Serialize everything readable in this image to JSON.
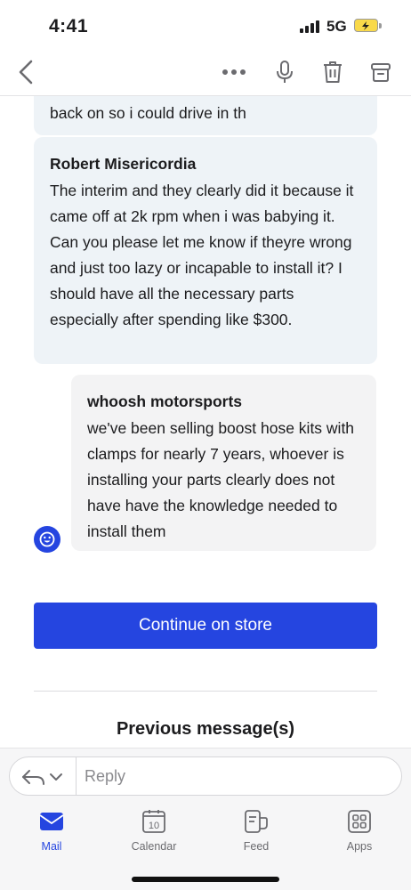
{
  "status": {
    "time": "4:41",
    "network": "5G"
  },
  "thread": {
    "prev_fragment": "back on so i could drive in th",
    "messages": [
      {
        "sender": "Robert Misericordia",
        "body": "The interim and they clearly did it because it came off at 2k rpm when i was babying it. Can you please let me know if theyre wrong and just too lazy or incapable to install it? I should have all the necessary parts especially after spending like $300."
      },
      {
        "sender": "whoosh motorsports",
        "body": "we've been selling boost hose kits with clamps for nearly 7 years, whoever is installing your parts clearly does not have have the knowledge needed to install them"
      }
    ],
    "cta_label": "Continue on store",
    "previous_heading": "Previous message(s)"
  },
  "reply": {
    "placeholder": "Reply"
  },
  "tabs": [
    {
      "label": "Mail"
    },
    {
      "label": "Calendar",
      "badge": "10"
    },
    {
      "label": "Feed"
    },
    {
      "label": "Apps"
    }
  ],
  "colors": {
    "accent": "#2545e0",
    "bubble_in": "#eef3f7",
    "bubble_out": "#f3f3f4"
  }
}
